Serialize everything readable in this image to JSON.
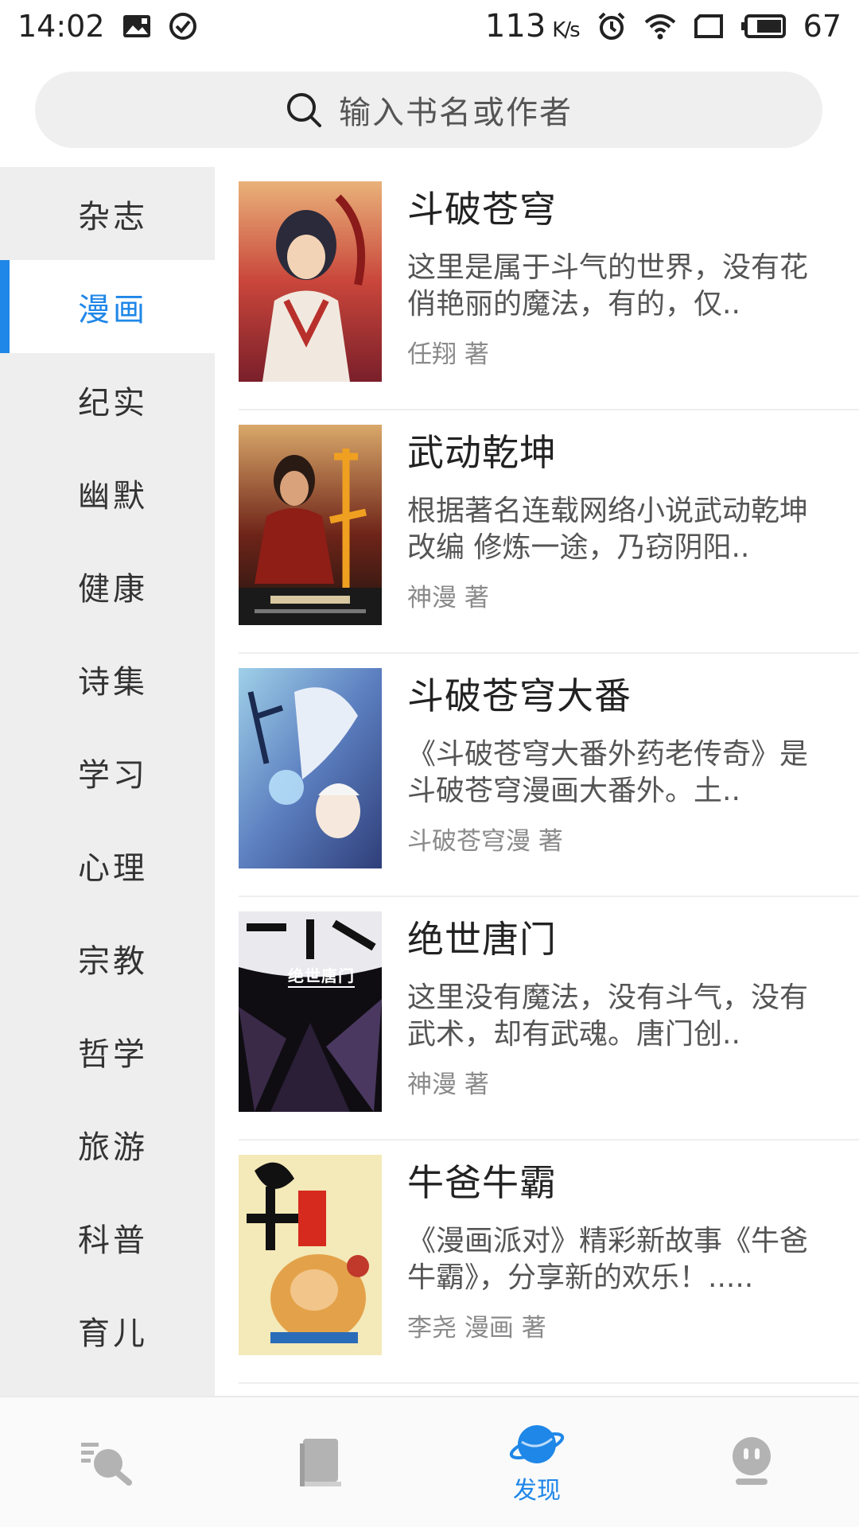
{
  "status_bar": {
    "time": "14:02",
    "speed_value": "113",
    "speed_unit": "K/s",
    "battery": "67",
    "icons": [
      "picture-icon",
      "check-circle-icon",
      "alarm-icon",
      "wifi-icon",
      "screen-icon",
      "battery-icon"
    ]
  },
  "search": {
    "placeholder": "输入书名或作者",
    "icon": "search-icon"
  },
  "sidebar": {
    "items": [
      {
        "label": "杂志"
      },
      {
        "label": "漫画",
        "active": true
      },
      {
        "label": "纪实"
      },
      {
        "label": "幽默"
      },
      {
        "label": "健康"
      },
      {
        "label": "诗集"
      },
      {
        "label": "学习"
      },
      {
        "label": "心理"
      },
      {
        "label": "宗教"
      },
      {
        "label": "哲学"
      },
      {
        "label": "旅游"
      },
      {
        "label": "科普"
      },
      {
        "label": "育儿"
      }
    ],
    "accent_color": "#1f87e8"
  },
  "books": [
    {
      "title": "斗破苍穹",
      "description": "这里是属于斗气的世界，没有花俏艳丽的魔法，有的，仅..",
      "author": "任翔 著"
    },
    {
      "title": "武动乾坤",
      "description": "根据著名连载网络小说武动乾坤改编 修炼一途，乃窃阴阳..",
      "author": "神漫 著"
    },
    {
      "title": "斗破苍穹大番",
      "description": "《斗破苍穹大番外药老传奇》是斗破苍穹漫画大番外。土..",
      "author": "斗破苍穹漫 著"
    },
    {
      "title": "绝世唐门",
      "description": "这里没有魔法，没有斗气，没有武术，却有武魂。唐门创..",
      "author": "神漫 著",
      "cover_text": "绝世唐门"
    },
    {
      "title": "牛爸牛霸",
      "description": "《漫画派对》精彩新故事《牛爸牛霸》，分享新的欢乐！.....",
      "author": "李尧 漫画 著"
    }
  ],
  "bottom_nav": {
    "tabs": [
      {
        "icon": "search-list-icon",
        "label": ""
      },
      {
        "icon": "book-icon",
        "label": ""
      },
      {
        "icon": "planet-icon",
        "label": "发现",
        "active": true
      },
      {
        "icon": "profile-icon",
        "label": ""
      }
    ],
    "active_color": "#1f87e8"
  }
}
